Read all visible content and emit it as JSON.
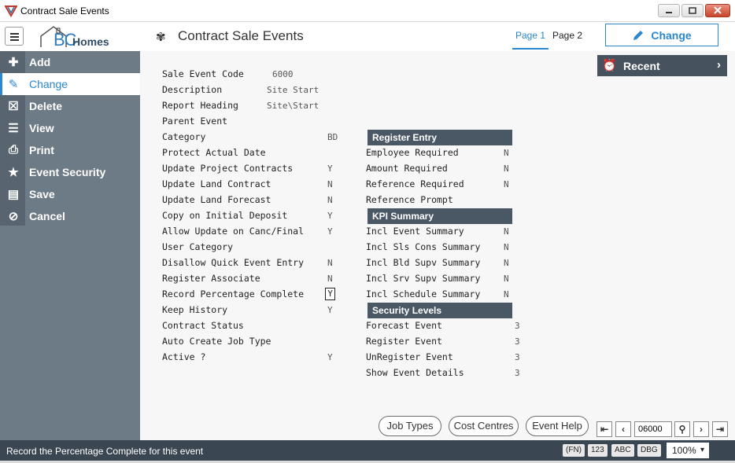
{
  "window": {
    "title": "Contract Sale Events"
  },
  "logo": {
    "bc": "BC",
    "homes": "Homes"
  },
  "header": {
    "page_title": "Contract Sale Events",
    "tabs": [
      "Page 1",
      "Page 2"
    ],
    "change_label": "Change"
  },
  "sidebar": {
    "items": [
      {
        "label": "Add",
        "icon": "plus-icon"
      },
      {
        "label": "Change",
        "icon": "pencil-icon"
      },
      {
        "label": "Delete",
        "icon": "trash-icon"
      },
      {
        "label": "View",
        "icon": "list-icon"
      },
      {
        "label": "Print",
        "icon": "printer-icon"
      },
      {
        "label": "Event Security",
        "icon": "star-icon"
      },
      {
        "label": "Save",
        "icon": "floppy-icon"
      },
      {
        "label": "Cancel",
        "icon": "ban-icon"
      }
    ]
  },
  "recent": {
    "label": "Recent"
  },
  "form": {
    "left": [
      {
        "label": "Sale Event Code",
        "value": "6000"
      },
      {
        "label": "Description",
        "value": "Site Start"
      },
      {
        "label": "Report Heading",
        "value": "Site\\Start"
      },
      {
        "label": "Parent Event",
        "value": ""
      },
      {
        "label": "Category",
        "value": "BD"
      },
      {
        "label": "Protect Actual Date",
        "value": ""
      },
      {
        "label": "Update Project Contracts",
        "value": "Y"
      },
      {
        "label": "Update Land Contract",
        "value": "N"
      },
      {
        "label": "Update Land Forecast",
        "value": "N"
      },
      {
        "label": "Copy on Initial Deposit",
        "value": "Y"
      },
      {
        "label": "Allow Update on Canc/Final",
        "value": "Y"
      },
      {
        "label": "User Category",
        "value": ""
      },
      {
        "label": "Disallow Quick Event Entry",
        "value": "N"
      },
      {
        "label": "Register Associate",
        "value": "N"
      },
      {
        "label": "Record Percentage Complete",
        "value": "Y"
      },
      {
        "label": "Keep History",
        "value": "Y"
      },
      {
        "label": "Contract Status",
        "value": ""
      },
      {
        "label": "Auto Create Job Type",
        "value": ""
      },
      {
        "label": "Active ?",
        "value": "Y"
      }
    ],
    "register_entry": {
      "heading": "Register Entry",
      "rows": [
        {
          "label": "Employee  Required",
          "value": "N"
        },
        {
          "label": "Amount    Required",
          "value": "N"
        },
        {
          "label": "Reference Required",
          "value": "N"
        },
        {
          "label": "Reference Prompt",
          "value": ""
        }
      ]
    },
    "kpi_summary": {
      "heading": "KPI Summary",
      "rows": [
        {
          "label": "Incl Event Summary",
          "value": "N"
        },
        {
          "label": "Incl Sls Cons Summary",
          "value": "N"
        },
        {
          "label": "Incl Bld Supv Summary",
          "value": "N"
        },
        {
          "label": "Incl Srv Supv Summary",
          "value": "N"
        },
        {
          "label": "Incl Schedule Summary",
          "value": "N"
        }
      ]
    },
    "security_levels": {
      "heading": "Security Levels",
      "rows": [
        {
          "label": "Forecast Event",
          "value": "3"
        },
        {
          "label": "Register Event",
          "value": "3"
        },
        {
          "label": "UnRegister Event",
          "value": "3"
        },
        {
          "label": "Show Event Details",
          "value": "3"
        }
      ]
    }
  },
  "bottom": {
    "buttons": [
      "Job Types",
      "Cost Centres",
      "Event Help"
    ],
    "record_value": "06000"
  },
  "status": {
    "text": "Record the Percentage Complete for this event",
    "chips": [
      "(FN)",
      "123",
      "ABC",
      "DBG"
    ],
    "zoom": "100%"
  },
  "colors": {
    "accent": "#2a87d0",
    "sidebar": "#6d7b87",
    "statusbar": "#3a4651",
    "section": "#4a5866"
  }
}
